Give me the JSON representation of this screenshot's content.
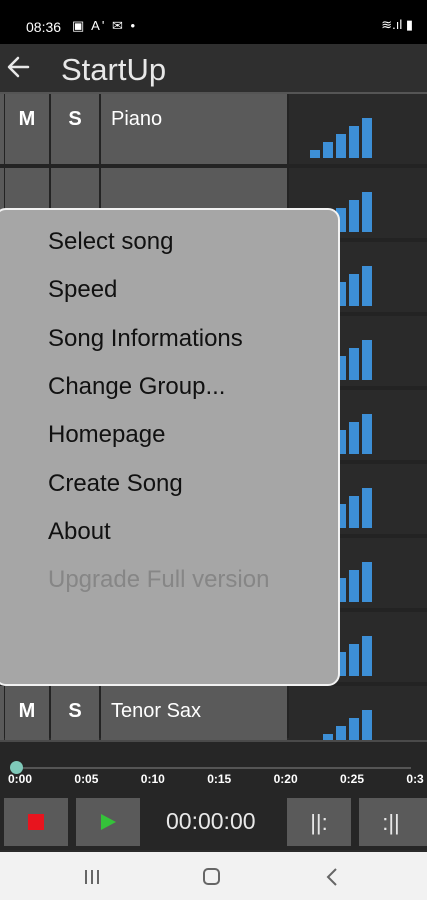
{
  "status": {
    "time": "08:36",
    "left_icons": "▣ A' ✉ •",
    "right_icons": "≋.ıl ▮"
  },
  "header": {
    "title": "StartUp"
  },
  "tracks": [
    {
      "mute": "M",
      "solo": "S",
      "name": "Piano",
      "level": 1.0
    },
    {
      "mute": "",
      "solo": "",
      "name": "",
      "level": 1.0
    },
    {
      "mute": "",
      "solo": "",
      "name": "",
      "level": 1.0
    },
    {
      "mute": "",
      "solo": "",
      "name": "",
      "level": 1.0
    },
    {
      "mute": "",
      "solo": "",
      "name": "",
      "level": 1.0
    },
    {
      "mute": "",
      "solo": "",
      "name": "",
      "level": 1.0
    },
    {
      "mute": "",
      "solo": "",
      "name": "",
      "level": 1.0
    },
    {
      "mute": "",
      "solo": "",
      "name": "",
      "level": 1.0
    },
    {
      "mute": "M",
      "solo": "S",
      "name": "Tenor Sax",
      "level": 1.0
    }
  ],
  "menu": {
    "items": [
      {
        "label": "Select song",
        "enabled": true
      },
      {
        "label": "Speed",
        "enabled": true
      },
      {
        "label": "Song Informations",
        "enabled": true
      },
      {
        "label": "Change Group...",
        "enabled": true
      },
      {
        "label": "Homepage",
        "enabled": true
      },
      {
        "label": "Create Song",
        "enabled": true
      },
      {
        "label": "About",
        "enabled": true
      },
      {
        "label": "Upgrade Full version",
        "enabled": false
      }
    ]
  },
  "timeline": {
    "ticks": [
      "0:00",
      "0:05",
      "0:10",
      "0:15",
      "0:20",
      "0:25",
      "0:3"
    ],
    "position": 0
  },
  "transport": {
    "time": "00:00:00",
    "loop_start_label": "||:",
    "loop_end_label": ":||",
    "colors": {
      "stop": "#e8141e",
      "play": "#35c23a",
      "meter": "#3d8fd6"
    }
  }
}
